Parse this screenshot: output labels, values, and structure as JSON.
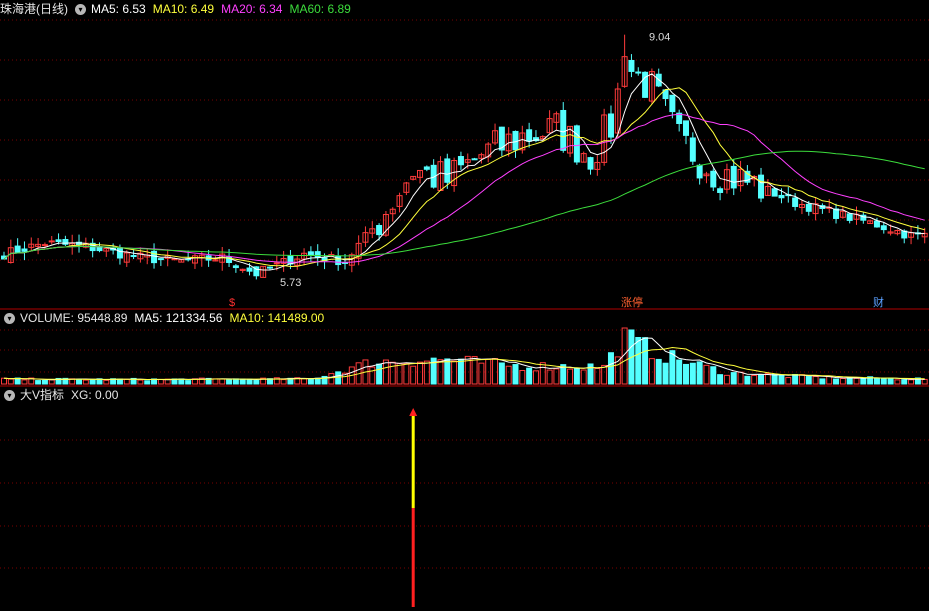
{
  "price_panel": {
    "title": "珠海港(日线)",
    "ma5_label": "MA5: 6.53",
    "ma10_label": "MA10: 6.49",
    "ma20_label": "MA20: 6.34",
    "ma60_label": "MA60: 6.89",
    "high_label": "9.04",
    "low_label": "5.73",
    "markers": [
      "$",
      "涨停",
      "财"
    ]
  },
  "volume_panel": {
    "title": "VOLUME: 95448.89",
    "ma5_label": "MA5: 121334.56",
    "ma10_label": "MA10: 141489.00"
  },
  "indicator_panel": {
    "title": "大V指标",
    "xg_label": "XG: 0.00"
  },
  "colors": {
    "up": "#ff3b3b",
    "down": "#54ffff",
    "ma5": "#ffffff",
    "ma10": "#ffff3c",
    "ma20": "#ff40ff",
    "ma60": "#3cdc3c",
    "grid": "#7a0000",
    "signal_top": "#ffff00",
    "signal_bottom": "#ff2020"
  },
  "chart_data": [
    {
      "type": "candlestick",
      "title": "珠海港(日线)",
      "high": 9.04,
      "low": 5.73,
      "key_prices": [
        {
          "day": 0,
          "price": 6.05
        },
        {
          "day": 6,
          "price": 6.2
        },
        {
          "day": 12,
          "price": 6.15
        },
        {
          "day": 20,
          "price": 6.0
        },
        {
          "day": 26,
          "price": 5.95
        },
        {
          "day": 32,
          "price": 6.0
        },
        {
          "day": 37,
          "price": 5.78
        },
        {
          "day": 44,
          "price": 6.05
        },
        {
          "day": 50,
          "price": 5.95
        },
        {
          "day": 55,
          "price": 6.5
        },
        {
          "day": 60,
          "price": 7.2
        },
        {
          "day": 65,
          "price": 7.05
        },
        {
          "day": 70,
          "price": 7.4
        },
        {
          "day": 76,
          "price": 7.65
        },
        {
          "day": 81,
          "price": 7.75
        },
        {
          "day": 86,
          "price": 7.4
        },
        {
          "day": 89,
          "price": 7.8
        },
        {
          "day": 91,
          "price": 8.65
        },
        {
          "day": 95,
          "price": 8.3
        },
        {
          "day": 99,
          "price": 7.6
        },
        {
          "day": 104,
          "price": 7.2
        },
        {
          "day": 110,
          "price": 7.0
        },
        {
          "day": 116,
          "price": 6.75
        },
        {
          "day": 122,
          "price": 6.6
        },
        {
          "day": 128,
          "price": 6.45
        },
        {
          "day": 133,
          "price": 6.3
        }
      ],
      "series": [
        {
          "name": "MA5",
          "last": 6.53
        },
        {
          "name": "MA10",
          "last": 6.49
        },
        {
          "name": "MA20",
          "last": 6.34
        },
        {
          "name": "MA60",
          "last": 6.89
        }
      ]
    },
    {
      "type": "bar",
      "title": "VOLUME",
      "last": 95448.89,
      "levels": [
        {
          "day": 0,
          "v": 30000
        },
        {
          "day": 20,
          "v": 28000
        },
        {
          "day": 45,
          "v": 32000
        },
        {
          "day": 54,
          "v": 140000
        },
        {
          "day": 65,
          "v": 155000
        },
        {
          "day": 75,
          "v": 115000
        },
        {
          "day": 88,
          "v": 110000
        },
        {
          "day": 91,
          "v": 300000
        },
        {
          "day": 96,
          "v": 190000
        },
        {
          "day": 106,
          "v": 70000
        },
        {
          "day": 120,
          "v": 40000
        },
        {
          "day": 134,
          "v": 32000
        }
      ],
      "series": [
        {
          "name": "MA5",
          "last": 121334.56
        },
        {
          "name": "MA10",
          "last": 141489.0
        }
      ]
    },
    {
      "type": "bar",
      "title": "大V指标",
      "series": [
        {
          "name": "XG",
          "last": 0.0
        }
      ],
      "signal_day": 60
    }
  ]
}
